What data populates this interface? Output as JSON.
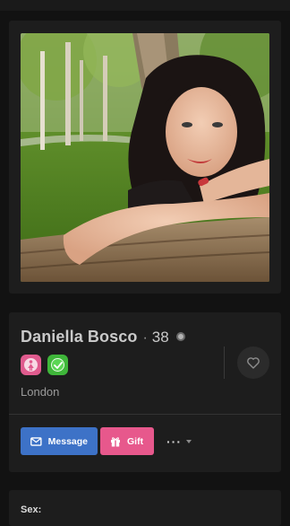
{
  "profile": {
    "name": "Daniella Bosco",
    "separator": "·",
    "age": "38",
    "city": "London",
    "online_status": "offline"
  },
  "badges": [
    {
      "icon": "female-icon",
      "color": "#e05b8e"
    },
    {
      "icon": "verified-check-icon",
      "color": "#3fb63a"
    }
  ],
  "actions": {
    "message_label": "Message",
    "gift_label": "Gift",
    "more_label": "···"
  },
  "details": {
    "sex_label": "Sex:"
  },
  "icons": {
    "like": "heart-icon",
    "message": "envelope-icon",
    "gift": "gift-icon",
    "more": "chevron-down-icon"
  },
  "colors": {
    "background": "#121212",
    "card": "#1d1d1d",
    "message_button": "#3d72c7",
    "gift_button": "#e7588c",
    "verified": "#3fb63a",
    "female": "#e05b8e"
  }
}
